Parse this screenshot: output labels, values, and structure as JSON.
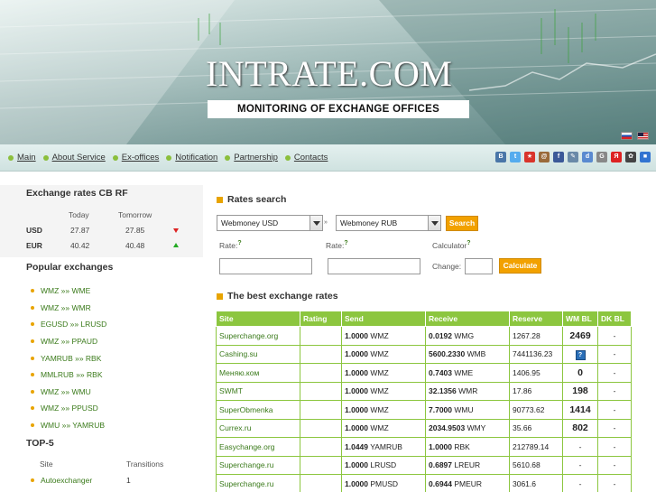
{
  "header": {
    "logo": "INTRATE.COM",
    "tagline": "MONITORING OF EXCHANGE OFFICES"
  },
  "nav": {
    "links": [
      "Main",
      "About Service",
      "Ex-offices",
      "Notification",
      "Partnership",
      "Contacts"
    ]
  },
  "share_icons": [
    {
      "name": "vkontakte-icon",
      "glyph": "B",
      "color": "#4a76a8"
    },
    {
      "name": "twitter-icon",
      "glyph": "t",
      "color": "#55acee"
    },
    {
      "name": "bookmark-icon",
      "glyph": "★",
      "color": "#d9342b"
    },
    {
      "name": "mail-icon",
      "glyph": "@",
      "color": "#9a6a3a"
    },
    {
      "name": "facebook-icon",
      "glyph": "f",
      "color": "#3b5998"
    },
    {
      "name": "livejournal-icon",
      "glyph": "✎",
      "color": "#6a8aa8"
    },
    {
      "name": "delicious-icon",
      "glyph": "d",
      "color": "#5a8ad0"
    },
    {
      "name": "google-icon",
      "glyph": "G",
      "color": "#888"
    },
    {
      "name": "yandex-icon",
      "glyph": "Я",
      "color": "#d22"
    },
    {
      "name": "myspace-icon",
      "glyph": "✿",
      "color": "#444"
    },
    {
      "name": "delicious-squares-icon",
      "glyph": "■",
      "color": "#3274d1"
    }
  ],
  "cb_rates": {
    "title": "Exchange rates CB RF",
    "col_today": "Today",
    "col_tomorrow": "Tomorrow",
    "rows": [
      {
        "currency": "USD",
        "today": "27.87",
        "tomorrow": "27.85",
        "trend": "down"
      },
      {
        "currency": "EUR",
        "today": "40.42",
        "tomorrow": "40.48",
        "trend": "up"
      }
    ]
  },
  "popular": {
    "title": "Popular exchanges",
    "items": [
      "WMZ »» WME",
      "WMZ »» WMR",
      "EGUSD »» LRUSD",
      "WMZ »» PPAUD",
      "YAMRUB »» RBK",
      "MMLRUB »» RBK",
      "WMZ »» WMU",
      "WMZ »» PPUSD",
      "WMU »» YAMRUB"
    ]
  },
  "top5": {
    "title": "TOP-5",
    "col_site": "Site",
    "col_transitions": "Transitions",
    "rows": [
      {
        "site": "Autoexchanger",
        "transitions": "1"
      }
    ]
  },
  "search": {
    "title": "Rates search",
    "from": "Webmoney USD",
    "sep": "»",
    "to": "Webmoney RUB",
    "search_label": "Search",
    "rate_label": "Rate:",
    "hint": "?",
    "calculator_label": "Calculator",
    "change_label": "Change:",
    "calculate_label": "Calculate"
  },
  "best": {
    "title": "The best exchange rates",
    "headers": [
      "Site",
      "Rating",
      "Send",
      "Receive",
      "Reserve",
      "WM BL",
      "DK BL"
    ],
    "rows": [
      {
        "site": "Superchange.org",
        "rating": "",
        "send_amt": "1.0000",
        "send_cur": "WMZ",
        "recv_amt": "0.0192",
        "recv_cur": "WMG",
        "reserve": "1267.28",
        "wmbl": "2469",
        "dkbl": "-"
      },
      {
        "site": "Cashing.su",
        "rating": "",
        "send_amt": "1.0000",
        "send_cur": "WMZ",
        "recv_amt": "5600.2330",
        "recv_cur": "WMB",
        "reserve": "7441136.23",
        "wmbl": "?",
        "dkbl": "-"
      },
      {
        "site": "Меняю.ком",
        "rating": "",
        "send_amt": "1.0000",
        "send_cur": "WMZ",
        "recv_amt": "0.7403",
        "recv_cur": "WME",
        "reserve": "1406.95",
        "wmbl": "0",
        "dkbl": "-"
      },
      {
        "site": "SWMT",
        "rating": "",
        "send_amt": "1.0000",
        "send_cur": "WMZ",
        "recv_amt": "32.1356",
        "recv_cur": "WMR",
        "reserve": "17.86",
        "wmbl": "198",
        "dkbl": "-"
      },
      {
        "site": "SuperObmenka",
        "rating": "",
        "send_amt": "1.0000",
        "send_cur": "WMZ",
        "recv_amt": "7.7000",
        "recv_cur": "WMU",
        "reserve": "90773.62",
        "wmbl": "1414",
        "dkbl": "-"
      },
      {
        "site": "Currex.ru",
        "rating": "",
        "send_amt": "1.0000",
        "send_cur": "WMZ",
        "recv_amt": "2034.9503",
        "recv_cur": "WMY",
        "reserve": "35.66",
        "wmbl": "802",
        "dkbl": "-"
      },
      {
        "site": "Easychange.org",
        "rating": "",
        "send_amt": "1.0449",
        "send_cur": "YAMRUB",
        "recv_amt": "1.0000",
        "recv_cur": "RBK",
        "reserve": "212789.14",
        "wmbl": "-",
        "dkbl": "-"
      },
      {
        "site": "Superchange.ru",
        "rating": "",
        "send_amt": "1.0000",
        "send_cur": "LRUSD",
        "recv_amt": "0.6897",
        "recv_cur": "LREUR",
        "reserve": "5610.68",
        "wmbl": "-",
        "dkbl": "-"
      },
      {
        "site": "Superchange.ru",
        "rating": "",
        "send_amt": "1.0000",
        "send_cur": "PMUSD",
        "recv_amt": "0.6944",
        "recv_cur": "PMEUR",
        "reserve": "3061.6",
        "wmbl": "-",
        "dkbl": "-"
      }
    ]
  }
}
